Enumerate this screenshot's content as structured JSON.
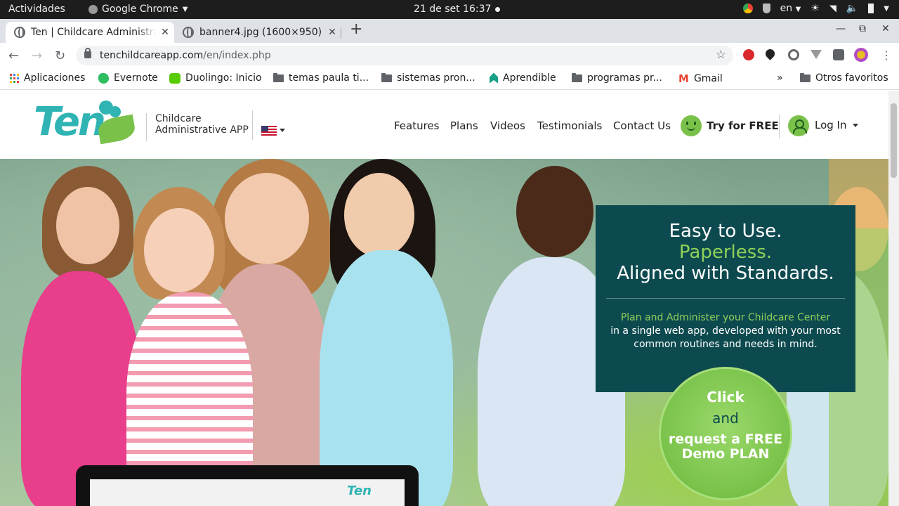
{
  "system": {
    "activities": "Actividades",
    "app_name": "Google Chrome",
    "clock": "21 de set  16:37",
    "language": "en"
  },
  "browser": {
    "tabs": [
      {
        "title": "Ten | Childcare Administrative APP",
        "active": true
      },
      {
        "title": "banner4.jpg (1600×950)",
        "active": false
      }
    ],
    "new_tab": "+",
    "url_host": "tenchildcareapp.com",
    "url_path": "/en/index.php",
    "bookmarks": [
      {
        "label": "Aplicaciones",
        "icon": "apps-grid-icon"
      },
      {
        "label": "Evernote",
        "icon": "evernote-icon"
      },
      {
        "label": "Duolingo: Inicio",
        "icon": "duolingo-icon"
      },
      {
        "label": "temas paula ti...",
        "icon": "folder-icon"
      },
      {
        "label": "sistemas pron...",
        "icon": "folder-icon"
      },
      {
        "label": "Aprendible",
        "icon": "aprendible-icon"
      },
      {
        "label": "programas pr...",
        "icon": "folder-icon"
      },
      {
        "label": "Gmail",
        "icon": "gmail-icon"
      }
    ],
    "more_bookmarks": "»",
    "other_bookmarks": "Otros favoritos"
  },
  "site": {
    "logo": "Ten",
    "tagline_1": "Childcare",
    "tagline_2": "Administrative APP",
    "nav": [
      "Features",
      "Plans",
      "Videos",
      "Testimonials",
      "Contact Us"
    ],
    "try_label": "Try for FREE",
    "login_label": "Log In"
  },
  "hero": {
    "headline_1": "Easy to Use.",
    "headline_2": "Paperless.",
    "headline_3": "Aligned with Standards.",
    "sub_green": "Plan and Administer your Childcare Center",
    "sub_white": "in a single web app, developed with your most common routines and needs in mind.",
    "cta_1": "Click",
    "cta_2": "and",
    "cta_3": "request a FREE Demo PLAN",
    "laptop_logo": "Ten"
  },
  "colors": {
    "teal": "#2fb4b3",
    "green": "#7ac14a",
    "card_bg": "#0d4a4f"
  }
}
